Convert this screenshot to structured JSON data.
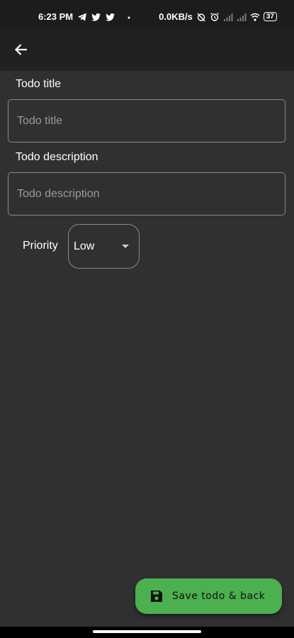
{
  "status_bar": {
    "time": "6:23 PM",
    "network_speed": "0.0KB/s",
    "battery_level": "37",
    "icons_left": [
      "telegram-icon",
      "twitter-icon",
      "twitter-icon",
      "dot-icon"
    ],
    "icons_right": [
      "alarm-off-icon",
      "alarm-icon",
      "signal-icon",
      "signal-icon",
      "wifi-icon",
      "battery-icon"
    ]
  },
  "app_bar": {
    "back_icon": "arrow-left-icon"
  },
  "form": {
    "title_label": "Todo title",
    "title_placeholder": "Todo title",
    "description_label": "Todo description",
    "description_placeholder": "Todo description",
    "priority_label": "Priority",
    "priority_selected": "Low"
  },
  "fab": {
    "icon": "save-icon",
    "label": "Save todo & back"
  },
  "colors": {
    "background": "#303030",
    "app_bar": "#212121",
    "status_bar": "#1c1c1c",
    "accent": "#4caf50"
  }
}
